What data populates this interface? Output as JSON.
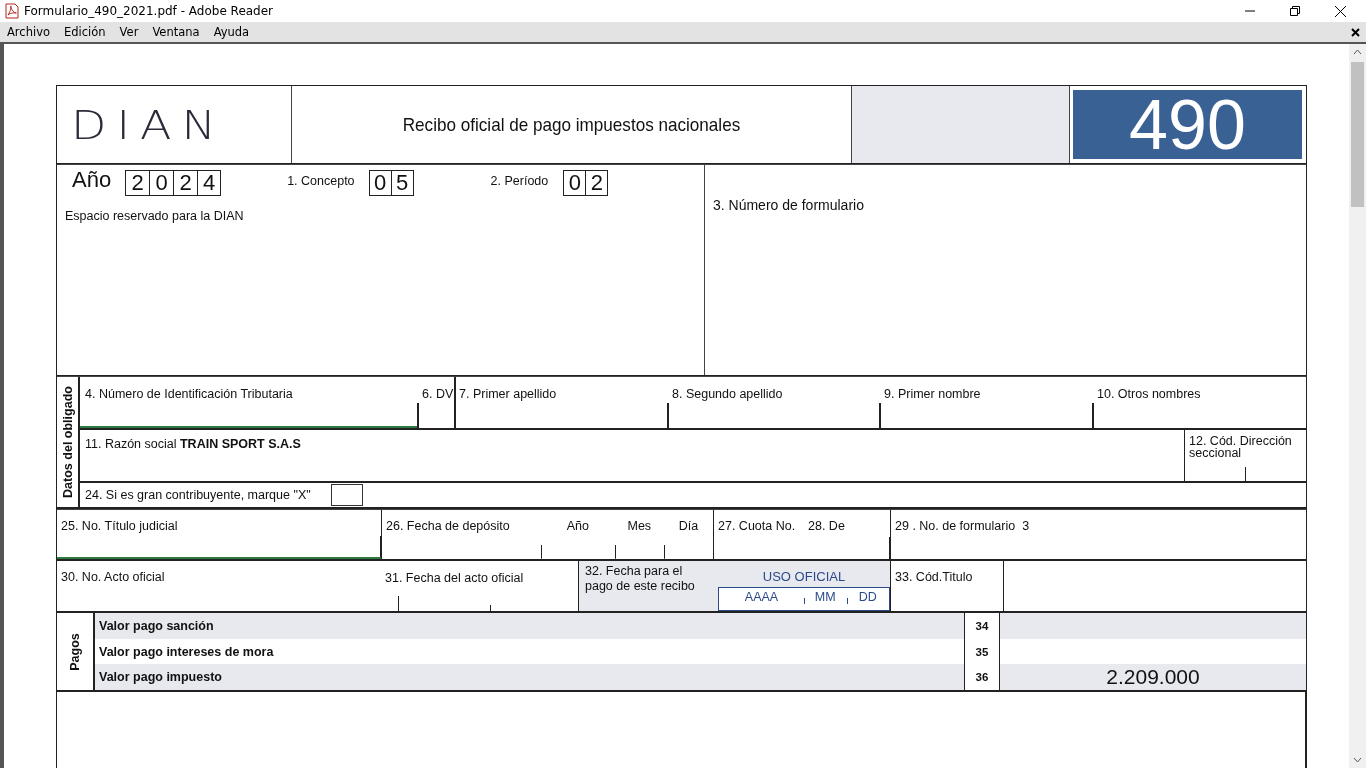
{
  "window": {
    "title": "Formulario_490_2021.pdf - Adobe Reader"
  },
  "menu": [
    "Archivo",
    "Edición",
    "Ver",
    "Ventana",
    "Ayuda"
  ],
  "form": {
    "header": {
      "logo": "DIAN",
      "title": "Recibo oficial de pago impuestos nacionales",
      "number": "490"
    },
    "general": {
      "year": {
        "label": "Año",
        "digits": [
          "2",
          "0",
          "2",
          "4"
        ]
      },
      "concept": {
        "label": "1. Concepto",
        "digits": [
          "0",
          "5"
        ]
      },
      "period": {
        "label": "2. Período",
        "digits": [
          "0",
          "2"
        ]
      },
      "reserved": "Espacio reservado para la DIAN",
      "form_number_label": "3. Número de formulario"
    },
    "obligado": {
      "section_label": "Datos del obligado",
      "id_fields": [
        {
          "label": "4.  Número de Identificación Tributaria"
        },
        {
          "label": "6. DV"
        },
        {
          "label": "7. Primer apellido"
        },
        {
          "label": "8. Segundo apellido"
        },
        {
          "label": "9. Primer nombre"
        },
        {
          "label": "10. Otros nombres"
        }
      ],
      "business_name": {
        "label": "11. Razón social",
        "value": "TRAIN SPORT S.A.S"
      },
      "office_code": "12. Cód. Dirección seccional",
      "large_taxpayer": {
        "label": "24. Si es gran contribuyente, marque \"X\"",
        "checked": false
      }
    },
    "deposit_row": {
      "judicial_title": "25. No. Título judicial",
      "deposit_date": {
        "label": "26. Fecha de depósito",
        "parts": [
          "Año",
          "Mes",
          "Día"
        ]
      },
      "installment": "27. Cuota No.",
      "of": "28. De",
      "form_number": {
        "label": "29 . No. de formulario",
        "value": "3"
      }
    },
    "act_row": {
      "act_number": "30. No. Acto oficial",
      "act_date": "31. Fecha del acto oficial",
      "payment_date": "32. Fecha para el pago de este recibo",
      "official_use": {
        "label": "USO OFICIAL",
        "parts": [
          "AAAA",
          "MM",
          "DD"
        ]
      },
      "title_code": "33. Cód.Titulo"
    },
    "payments": {
      "section_label": "Pagos",
      "rows": [
        {
          "label": "Valor pago sanción",
          "number": "34"
        },
        {
          "label": "Valor pago intereses de mora",
          "number": "35"
        },
        {
          "label": "Valor pago impuesto",
          "number": "36",
          "value": "2.209.000"
        }
      ]
    }
  }
}
